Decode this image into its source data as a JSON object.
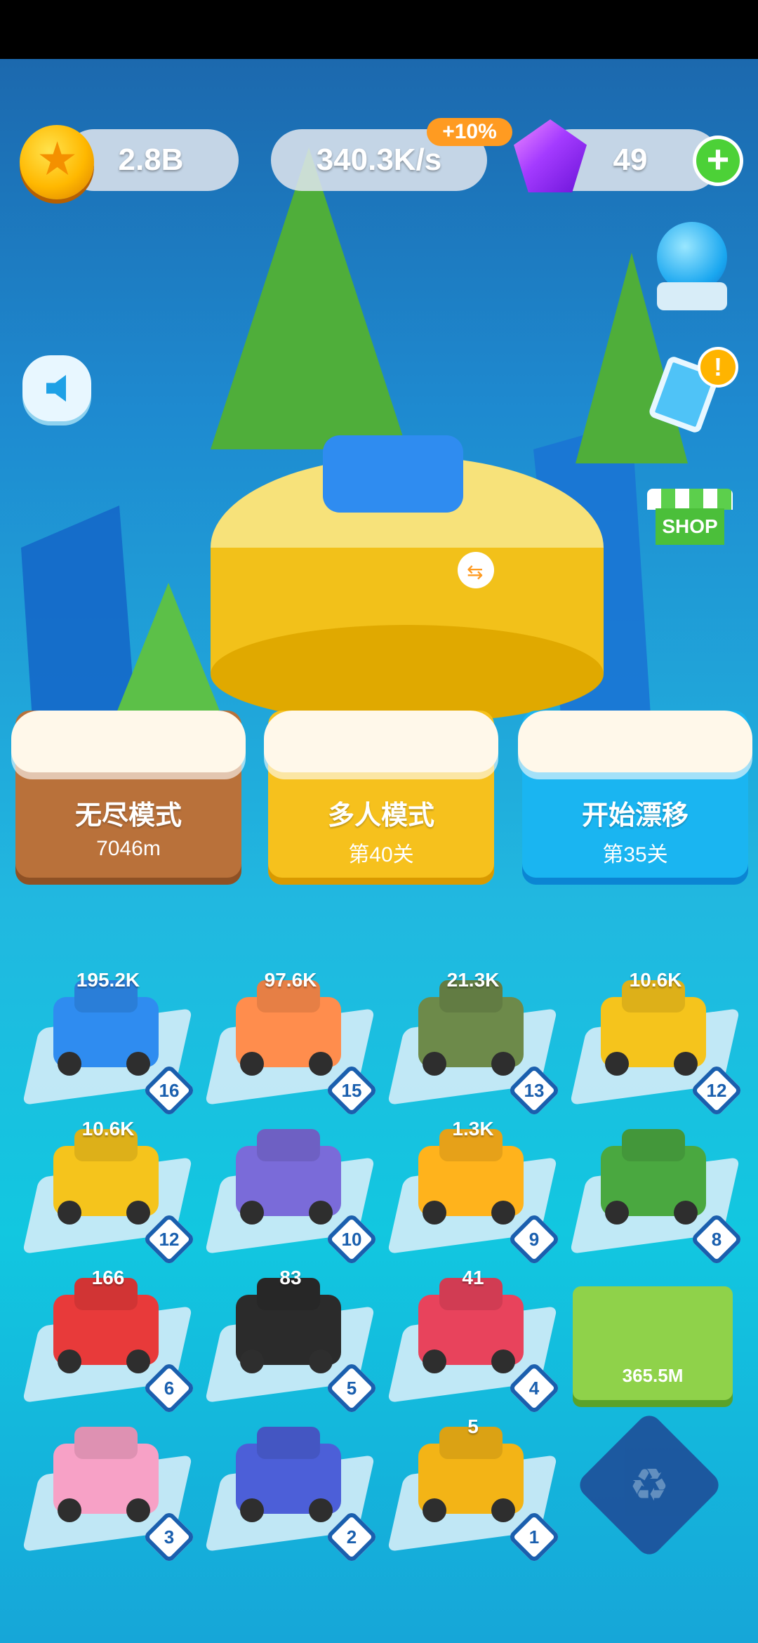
{
  "resources": {
    "coins": "2.8B",
    "income_rate": "340.3K/s",
    "income_boost": "+10%",
    "gems": "49"
  },
  "side_buttons": {
    "shop_label": "SHOP",
    "task_alert": "!"
  },
  "modes": [
    {
      "title": "无尽模式",
      "subtitle": "7046m"
    },
    {
      "title": "多人模式",
      "subtitle": "第40关"
    },
    {
      "title": "开始漂移",
      "subtitle": "第35关"
    }
  ],
  "garage": [
    {
      "earning": "195.2K",
      "level": "16",
      "color": "#2f8cf0"
    },
    {
      "earning": "97.6K",
      "level": "15",
      "color": "#ff8d4d"
    },
    {
      "earning": "21.3K",
      "level": "13",
      "color": "#6d8a4a"
    },
    {
      "earning": "10.6K",
      "level": "12",
      "color": "#f5c41c"
    },
    {
      "earning": "10.6K",
      "level": "12",
      "color": "#f5c41c"
    },
    {
      "earning": "",
      "level": "10",
      "color": "#7a6bd9"
    },
    {
      "earning": "1.3K",
      "level": "9",
      "color": "#ffb31c"
    },
    {
      "earning": "",
      "level": "8",
      "color": "#4aa840"
    },
    {
      "earning": "166",
      "level": "6",
      "color": "#e83a3a"
    },
    {
      "earning": "83",
      "level": "5",
      "color": "#2b2b2b"
    },
    {
      "earning": "41",
      "level": "4",
      "color": "#e8435c"
    },
    {
      "earning": "",
      "level": "3",
      "color": "#f7a1c6"
    },
    {
      "earning": "",
      "level": "2",
      "color": "#4c5fd8"
    },
    {
      "earning": "5",
      "level": "1",
      "color": "#f3b416"
    }
  ],
  "offer": {
    "price": "365.5M"
  },
  "colors": {
    "accent": "#1a5fae",
    "coin": "#ffb800",
    "gem": "#a43bff"
  }
}
